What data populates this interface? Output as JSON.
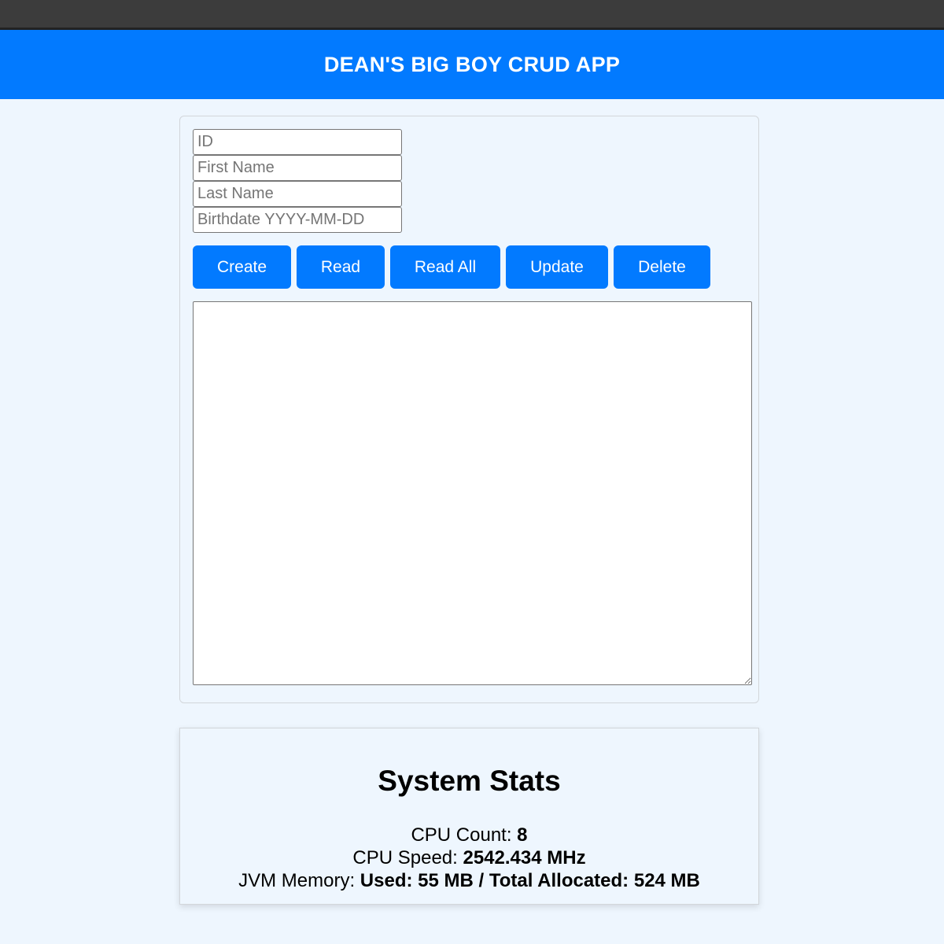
{
  "header": {
    "title": "DEAN'S BIG BOY CRUD APP"
  },
  "form": {
    "id_placeholder": "ID",
    "first_name_placeholder": "First Name",
    "last_name_placeholder": "Last Name",
    "birthdate_placeholder": "Birthdate YYYY-MM-DD",
    "id_value": "",
    "first_name_value": "",
    "last_name_value": "",
    "birthdate_value": ""
  },
  "buttons": {
    "create": "Create",
    "read": "Read",
    "read_all": "Read All",
    "update": "Update",
    "delete": "Delete"
  },
  "output": {
    "value": ""
  },
  "stats": {
    "title": "System Stats",
    "cpu_count_label": "CPU Count: ",
    "cpu_count_value": "8",
    "cpu_speed_label": "CPU Speed: ",
    "cpu_speed_value": "2542.434 MHz",
    "jvm_memory_label": "JVM Memory: ",
    "jvm_memory_value": "Used: 55 MB / Total Allocated: 524 MB"
  },
  "colors": {
    "accent": "#027aff",
    "background": "#eef6fe",
    "topbar": "#3c3c3c"
  }
}
